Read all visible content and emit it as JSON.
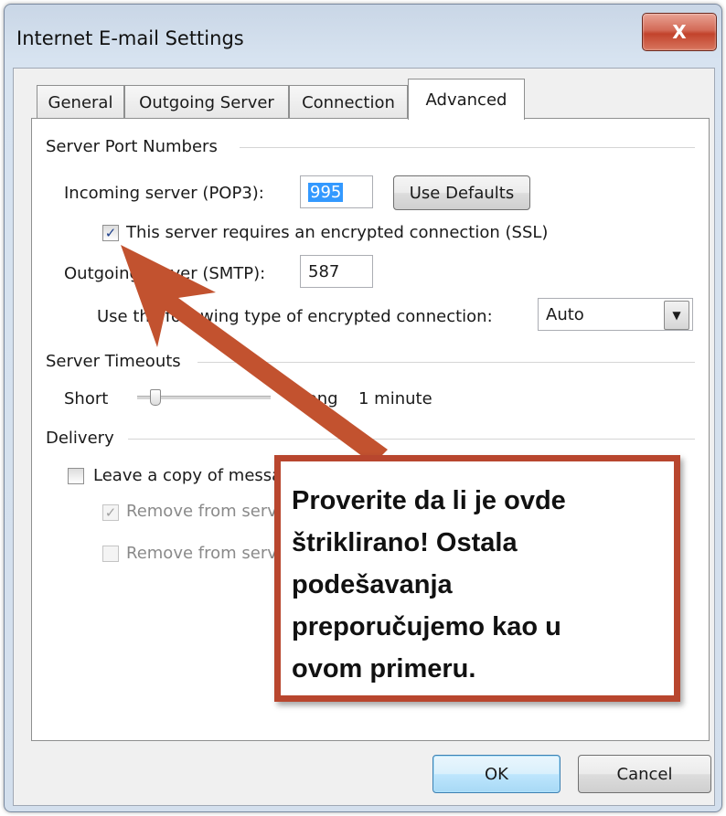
{
  "window": {
    "title": "Internet E-mail Settings",
    "close_label": "X"
  },
  "tabs": [
    {
      "label": "General",
      "active": false
    },
    {
      "label": "Outgoing Server",
      "active": false
    },
    {
      "label": "Connection",
      "active": false
    },
    {
      "label": "Advanced",
      "active": true
    }
  ],
  "server_ports": {
    "group_label": "Server Port Numbers",
    "incoming_label": "Incoming server (POP3):",
    "incoming_value": "995",
    "use_defaults_label": "Use Defaults",
    "ssl_checkbox_label": "This server requires an encrypted connection (SSL)",
    "ssl_checked": true,
    "outgoing_label": "Outgoing server (SMTP):",
    "outgoing_value": "587",
    "encryption_label": "Use the following type of encrypted connection:",
    "encryption_value": "Auto"
  },
  "timeouts": {
    "group_label": "Server Timeouts",
    "short_label": "Short",
    "long_label": "Long",
    "value_label": "1 minute",
    "slider_fraction": 0.14
  },
  "delivery": {
    "group_label": "Delivery",
    "leave_copy_label": "Leave a copy of messages on the server",
    "leave_copy_checked": false,
    "remove_after_label": "Remove from server after",
    "remove_after_checked": true,
    "remove_deleted_label": "Remove from server when deleted",
    "remove_deleted_checked": false
  },
  "buttons": {
    "ok_label": "OK",
    "cancel_label": "Cancel"
  },
  "callout": {
    "text": "Proverite da li je ovde\nštriklirano! Ostala\npodešavanja\npreporučujemo kao u\novom primeru.",
    "border_color": "#b8462e",
    "arrow_color": "#c2522f"
  }
}
